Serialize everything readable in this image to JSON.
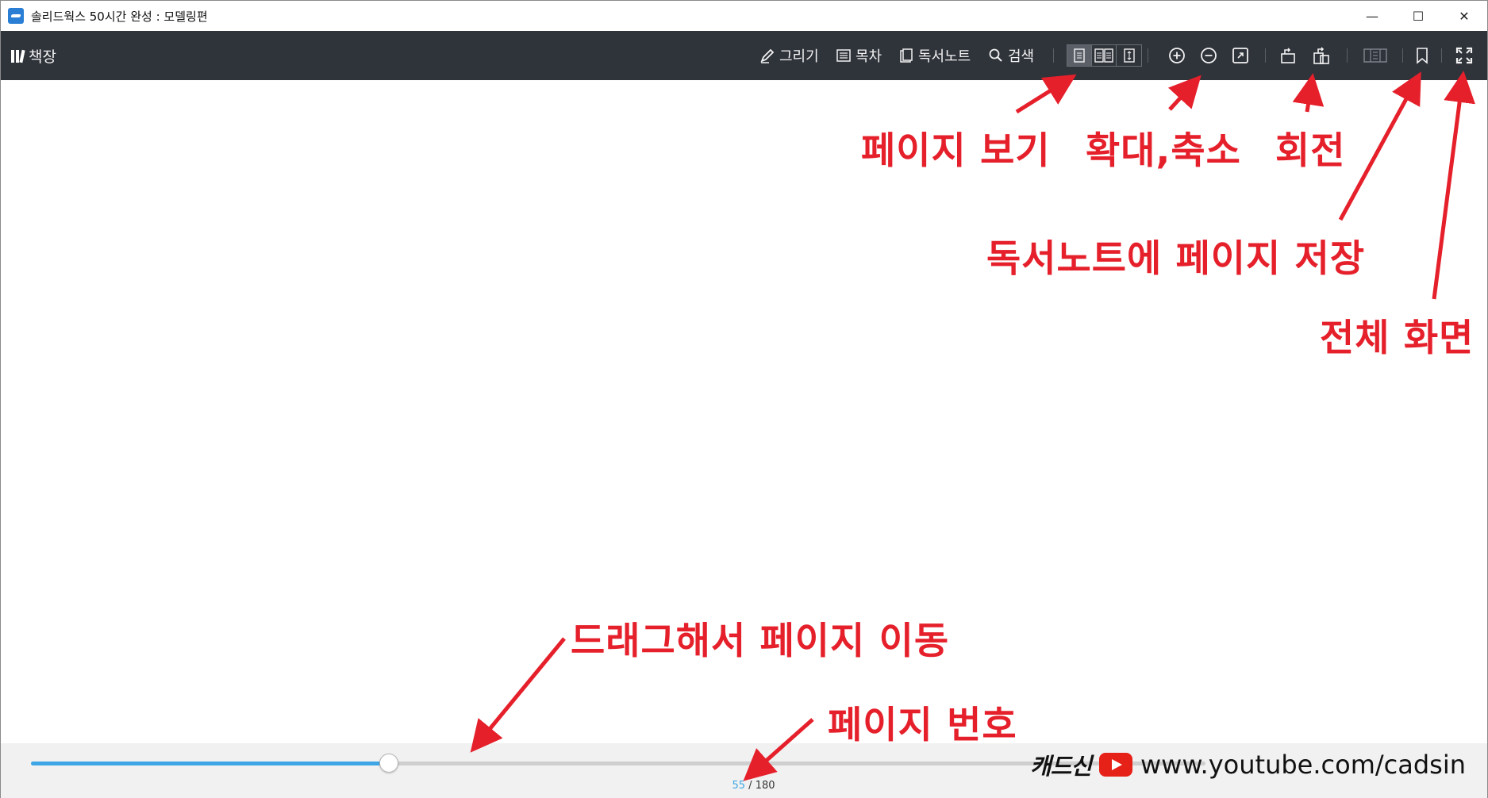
{
  "window": {
    "title": "솔리드웍스 50시간 완성 : 모델링편",
    "controls": {
      "minimize": "—",
      "maximize": "☐",
      "close": "✕"
    }
  },
  "toolbar": {
    "shelf_label": "책장",
    "draw_label": "그리기",
    "toc_label": "목차",
    "notes_label": "독서노트",
    "search_label": "검색",
    "icons": [
      "shelf-icon",
      "pen-icon",
      "toc-list-icon",
      "notebook-icon",
      "search-icon",
      "single-page-view-icon",
      "double-page-view-icon",
      "scroll-view-icon",
      "zoom-in-icon",
      "zoom-out-icon",
      "fit-page-icon",
      "rotate-left-icon",
      "rotate-right-icon",
      "notes-panel-icon",
      "bookmark-icon",
      "fullscreen-icon"
    ]
  },
  "pager": {
    "current_page": "55",
    "separator": "/",
    "total_pages": "180",
    "slider_fraction": 0.305
  },
  "annotations": {
    "page_view": "페이지 보기",
    "zoom": "확대,축소",
    "rotate": "회전",
    "save_to_notes": "독서노트에 페이지 저장",
    "fullscreen": "전체 화면",
    "drag_to_move": "드래그해서 페이지 이동",
    "page_number": "페이지 번호"
  },
  "watermark": {
    "brand": "캐드신",
    "url": "www.youtube.com/cadsin"
  },
  "colors": {
    "toolbar_bg": "#2f333a",
    "annotation_red": "#e5202b",
    "slider_blue": "#3ea6e6"
  }
}
